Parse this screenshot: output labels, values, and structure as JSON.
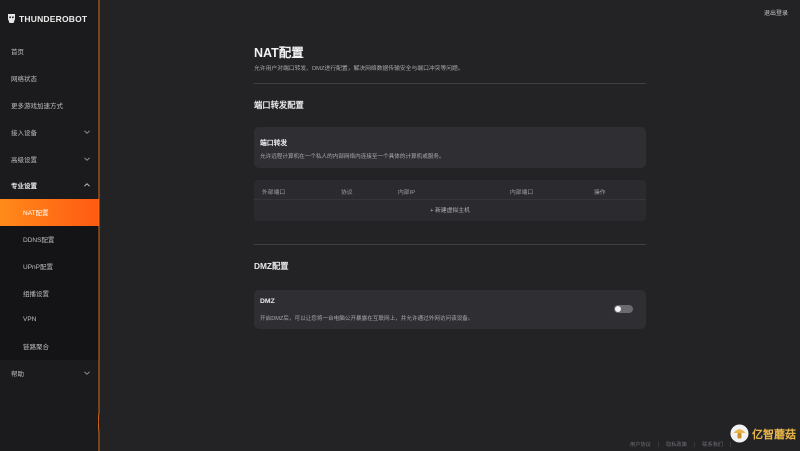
{
  "brand": {
    "name": "THUNDEROBOT",
    "accent_color": "#ff6a14"
  },
  "header": {
    "logout_label": "退出登录"
  },
  "sidebar": {
    "items": [
      {
        "label": "首页"
      },
      {
        "label": "网络状态"
      },
      {
        "label": "更多游戏加速方式"
      },
      {
        "label": "接入设备",
        "icon": "chevron-down"
      },
      {
        "label": "高级设置",
        "icon": "chevron-down"
      },
      {
        "label": "专业设置",
        "icon": "chevron-up",
        "expanded": true
      }
    ],
    "sub_items": [
      {
        "label": "NAT配置",
        "active": true
      },
      {
        "label": "DDNS配置"
      },
      {
        "label": "UPnP配置"
      },
      {
        "label": "组播设置"
      },
      {
        "label": "VPN"
      },
      {
        "label": "链路聚合"
      }
    ],
    "help": {
      "label": "帮助",
      "icon": "chevron-down"
    }
  },
  "main": {
    "title": "NAT配置",
    "description": "允许用户对端口转发、DMZ进行配置，解决网络数据传输安全与端口冲突等问题。",
    "port_forward": {
      "section_title": "端口转发配置",
      "card_title": "端口转发",
      "card_desc": "允许远程计算机在一个私人的内部网络内连接至一个具体的计算机或服务。",
      "table": {
        "columns": [
          "外部端口",
          "协议",
          "内部IP",
          "内部端口",
          "操作"
        ],
        "add_label": "+ 新建虚拟主机"
      }
    },
    "dmz": {
      "section_title": "DMZ配置",
      "card_title": "DMZ",
      "card_desc": "开启DMZ后，可以让您将一台电脑公开暴露在互联网上，并允许通过外网访问该设备。",
      "enabled": false
    }
  },
  "footer": {
    "links": [
      "用户协议",
      "隐私政策",
      "联系我们"
    ]
  },
  "watermark": {
    "text": "亿智蘑菇"
  }
}
